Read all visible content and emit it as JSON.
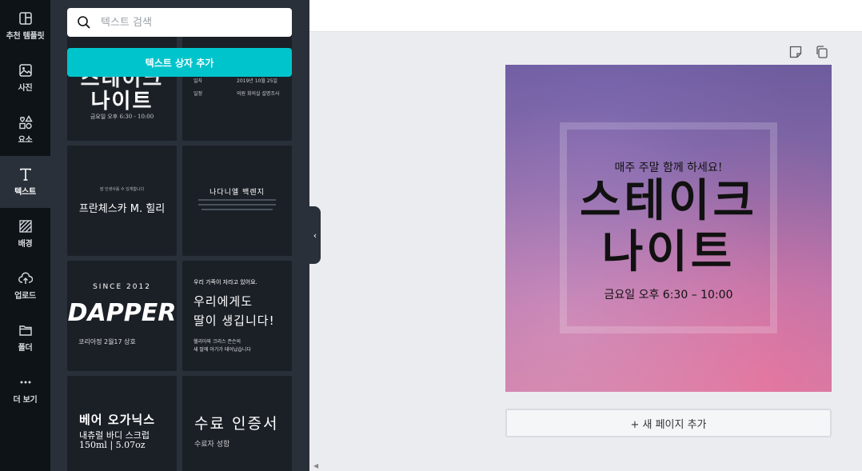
{
  "sidebar": {
    "items": [
      {
        "label": "추천 템플릿",
        "icon": "template-icon"
      },
      {
        "label": "사진",
        "icon": "photo-icon"
      },
      {
        "label": "요소",
        "icon": "elements-icon"
      },
      {
        "label": "텍스트",
        "icon": "text-icon"
      },
      {
        "label": "배경",
        "icon": "background-icon"
      },
      {
        "label": "업로드",
        "icon": "upload-icon"
      },
      {
        "label": "폴더",
        "icon": "folder-icon"
      },
      {
        "label": "더 보기",
        "icon": "more-icon"
      }
    ],
    "active_index": 3
  },
  "panel": {
    "search_placeholder": "텍스트 검색",
    "add_textbox_label": "텍스트 상자 추가",
    "templates": [
      {
        "name": "steak-night",
        "lines": [
          "스테이크",
          "나이트",
          "금요일 오후 6:30 - 10:00"
        ]
      },
      {
        "name": "date-place",
        "lines": [
          "일자",
          "2019년 10월 25일",
          "일정",
          "의원 회의실 설명조사"
        ]
      },
      {
        "name": "francesca",
        "lines": [
          "잠 인생사를 수 있게합니다",
          "프란체스카 M. 힐리"
        ]
      },
      {
        "name": "daniel",
        "lines": [
          "나다니엘 백렌지"
        ]
      },
      {
        "name": "dapper",
        "lines": [
          "SINCE 2012",
          "DAPPER",
          "코리아정 2월17 상호"
        ]
      },
      {
        "name": "daughter",
        "lines": [
          "우리 가족이 자라고 있어요.",
          "우리에게도",
          "딸이 생깁니다!",
          "헬리아와 크리스 존슨의",
          "새 딸에 아기가 태어났습니다"
        ]
      },
      {
        "name": "bear-organics",
        "lines": [
          "베어 오가닉스",
          "내츄럴 바디 스크럽",
          "150ml | 5.07oz"
        ]
      },
      {
        "name": "certificate",
        "lines": [
          "수료 인증서",
          "수료자 성함"
        ]
      }
    ]
  },
  "canvas": {
    "subtitle": "매주 주말 함께 하세요!",
    "title_line1": "스테이크",
    "title_line2": "나이트",
    "time": "금요일 오후 6:30 – 10:00",
    "add_page_label": "+ 새 페이지 추가",
    "collapse_glyph": "‹"
  },
  "colors": {
    "rail_bg": "#0e1318",
    "panel_bg": "#293039",
    "tile_bg": "#1b2027",
    "accent": "#00c4cc",
    "workspace_bg": "#ebecf0"
  }
}
